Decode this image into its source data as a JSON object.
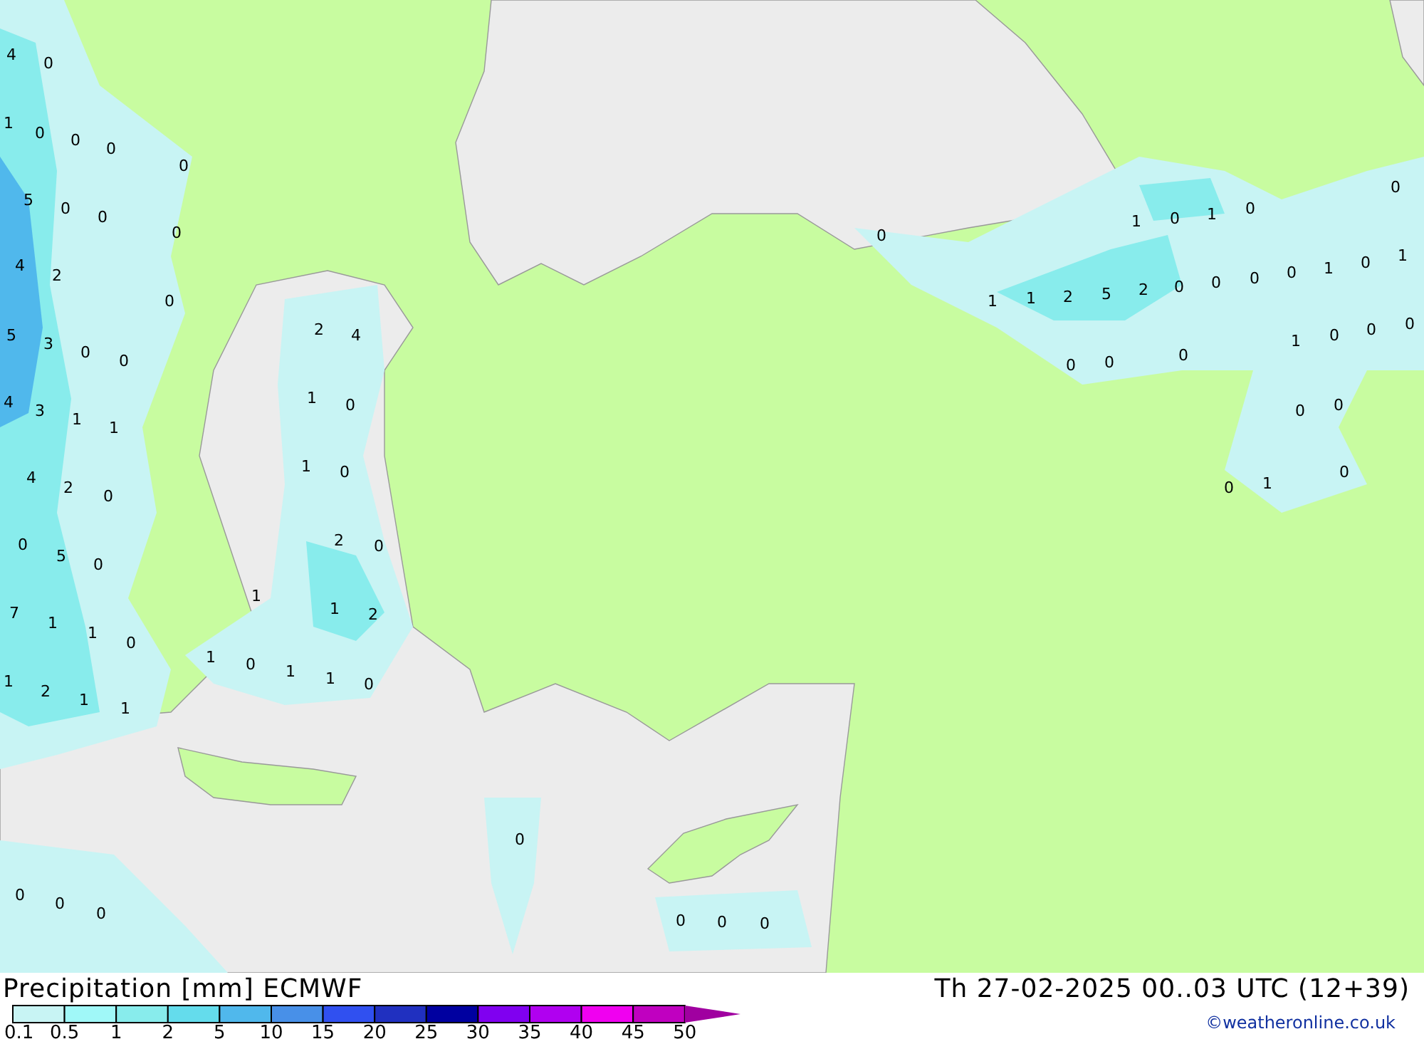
{
  "map": {
    "labels": [
      "4",
      "0",
      "1",
      "0",
      "0",
      "0",
      "0",
      "5",
      "0",
      "0",
      "0",
      "4",
      "2",
      "0",
      "5",
      "3",
      "0",
      "0",
      "2",
      "4",
      "4",
      "3",
      "1",
      "1",
      "1",
      "0",
      "4",
      "2",
      "0",
      "1",
      "0",
      "0",
      "5",
      "0",
      "2",
      "0",
      "7",
      "1",
      "1",
      "0",
      "1",
      "1",
      "2",
      "1",
      "2",
      "1",
      "1",
      "1",
      "0",
      "1",
      "1",
      "0",
      "0",
      "0",
      "0",
      "0",
      "0",
      "0",
      "0",
      "0",
      "1",
      "0",
      "1",
      "0",
      "0",
      "1",
      "1",
      "2",
      "5",
      "2",
      "0",
      "0",
      "0",
      "0",
      "1",
      "0",
      "1",
      "1",
      "0",
      "0",
      "0",
      "0",
      "0",
      "0",
      "0",
      "0",
      "0",
      "0",
      "1"
    ]
  },
  "footer": {
    "title": "Precipitation [mm] ECMWF",
    "valid_time": "Th 27-02-2025 00..03 UTC (12+39)",
    "credit": "©weatheronline.co.uk"
  },
  "legend": {
    "segments": [
      {
        "kind": "bar",
        "color": "#c8f4f4"
      },
      {
        "kind": "bar",
        "color": "#a0f8f8"
      },
      {
        "kind": "bar",
        "color": "#88ecec"
      },
      {
        "kind": "bar",
        "color": "#64dcec"
      },
      {
        "kind": "bar",
        "color": "#50b8ec"
      },
      {
        "kind": "bar",
        "color": "#4890e8"
      },
      {
        "kind": "bar",
        "color": "#3050f0"
      },
      {
        "kind": "bar",
        "color": "#2030c0"
      },
      {
        "kind": "bar",
        "color": "#0000a0"
      },
      {
        "kind": "bar",
        "color": "#8000f0"
      },
      {
        "kind": "bar",
        "color": "#b000f0"
      },
      {
        "kind": "bar",
        "color": "#f000f0"
      },
      {
        "kind": "bar",
        "color": "#c000c0"
      },
      {
        "kind": "arrow",
        "color": "#a000a0"
      }
    ],
    "ticks": [
      "0.1",
      "0.5",
      "1",
      "2",
      "5",
      "10",
      "15",
      "20",
      "25",
      "30",
      "35",
      "40",
      "45",
      "50"
    ]
  }
}
